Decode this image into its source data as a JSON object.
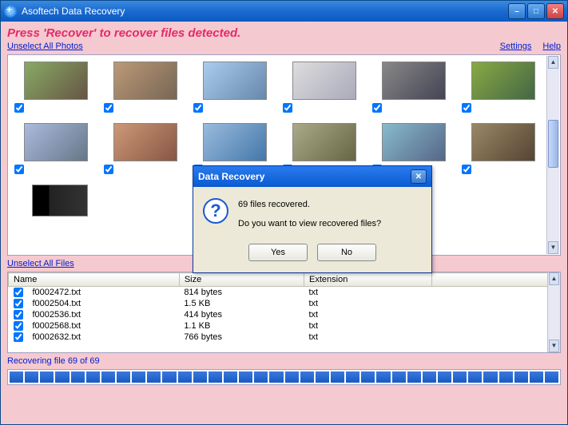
{
  "titlebar": {
    "title": "Asoftech Data Recovery"
  },
  "instructions": "Press 'Recover' to recover files detected.",
  "links": {
    "unselect_photos": "Unselect All Photos",
    "unselect_files": "Unselect All Files",
    "settings": "Settings",
    "help": "Help"
  },
  "files_table": {
    "headers": {
      "name": "Name",
      "size": "Size",
      "extension": "Extension"
    },
    "rows": [
      {
        "name": "f0002472.txt",
        "size": "814 bytes",
        "ext": "txt"
      },
      {
        "name": "f0002504.txt",
        "size": "1.5 KB",
        "ext": "txt"
      },
      {
        "name": "f0002536.txt",
        "size": "414 bytes",
        "ext": "txt"
      },
      {
        "name": "f0002568.txt",
        "size": "1.1 KB",
        "ext": "txt"
      },
      {
        "name": "f0002632.txt",
        "size": "766 bytes",
        "ext": "txt"
      }
    ]
  },
  "status": "Recovering file 69 of 69",
  "dialog": {
    "title": "Data Recovery",
    "line1": "69 files recovered.",
    "line2": "Do you want to view recovered files?",
    "yes": "Yes",
    "no": "No"
  }
}
